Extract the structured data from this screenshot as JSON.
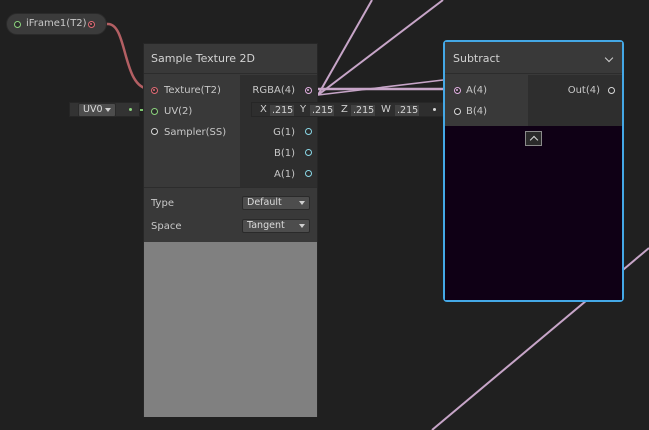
{
  "property_node": {
    "label": "iFrame1(T2)"
  },
  "sample_node": {
    "title": "Sample Texture 2D",
    "inputs": [
      "Texture(T2)",
      "UV(2)",
      "Sampler(SS)"
    ],
    "outputs": [
      "RGBA(4)",
      "G(1)",
      "B(1)",
      "A(1)"
    ],
    "type_label": "Type",
    "type_value": "Default",
    "space_label": "Space",
    "space_value": "Tangent"
  },
  "uv_input": {
    "value": "UV0"
  },
  "vector_input": {
    "x_label": "X",
    "x_value": ".215",
    "y_label": "Y",
    "y_value": ".215",
    "z_label": "Z",
    "z_value": ".215",
    "w_label": "W",
    "w_value": ".215"
  },
  "subtract_node": {
    "title": "Subtract",
    "inputs": [
      "A(4)",
      "B(4)"
    ],
    "output": "Out(4)"
  },
  "colors": {
    "texture_wire": "#b35f63",
    "vector_wire": "#c7a5c8",
    "uv_wire": "#7cc76e",
    "selection": "#44a8e6"
  }
}
